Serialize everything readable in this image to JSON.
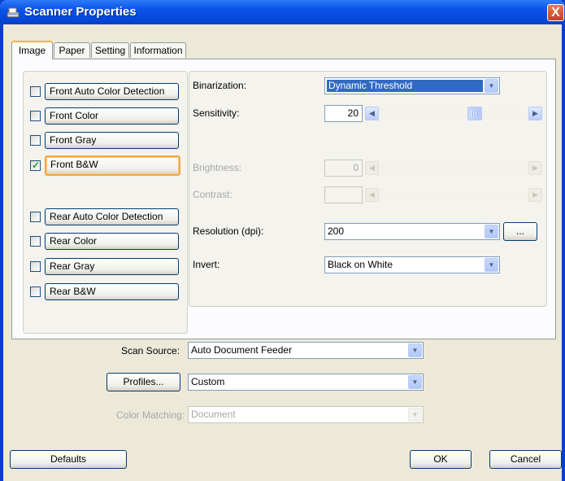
{
  "window": {
    "title": "Scanner Properties",
    "close_symbol": "X"
  },
  "tabs": [
    {
      "label": "Image",
      "active": true
    },
    {
      "label": "Paper",
      "active": false
    },
    {
      "label": "Setting",
      "active": false
    },
    {
      "label": "Information",
      "active": false
    }
  ],
  "image_types": [
    {
      "label": "Front Auto Color Detection",
      "checked": false
    },
    {
      "label": "Front Color",
      "checked": false
    },
    {
      "label": "Front Gray",
      "checked": false
    },
    {
      "label": "Front B&W",
      "checked": true
    },
    {
      "label": "Rear Auto Color Detection",
      "checked": false
    },
    {
      "label": "Rear Color",
      "checked": false
    },
    {
      "label": "Rear Gray",
      "checked": false
    },
    {
      "label": "Rear B&W",
      "checked": false
    }
  ],
  "settings": {
    "binarization": {
      "label": "Binarization:",
      "value": "Dynamic Threshold"
    },
    "sensitivity": {
      "label": "Sensitivity:",
      "value": "20"
    },
    "brightness": {
      "label": "Brightness:",
      "value": "0"
    },
    "contrast": {
      "label": "Contrast:",
      "value": ""
    },
    "resolution": {
      "label": "Resolution (dpi):",
      "value": "200",
      "more_label": "..."
    },
    "invert": {
      "label": "Invert:",
      "value": "Black on White"
    }
  },
  "scan_source": {
    "label": "Scan Source:",
    "value": "Auto Document Feeder"
  },
  "profiles": {
    "button_label": "Profiles...",
    "value": "Custom"
  },
  "color_matching": {
    "label": "Color Matching:",
    "value": "Document"
  },
  "footer": {
    "defaults_label": "Defaults",
    "ok_label": "OK",
    "cancel_label": "Cancel"
  },
  "colors": {
    "titlebar": "#0a52e8",
    "dialog_bg": "#ece9d8",
    "focus": "#f3a34b",
    "check": "#21a121",
    "selection": "#316ac5"
  },
  "icons": {
    "window": "scanner-icon",
    "close": "close-icon",
    "dropdown": "chevron-down-icon",
    "scroll_left": "arrow-left-icon",
    "scroll_right": "arrow-right-icon",
    "check": "checkmark-icon"
  }
}
